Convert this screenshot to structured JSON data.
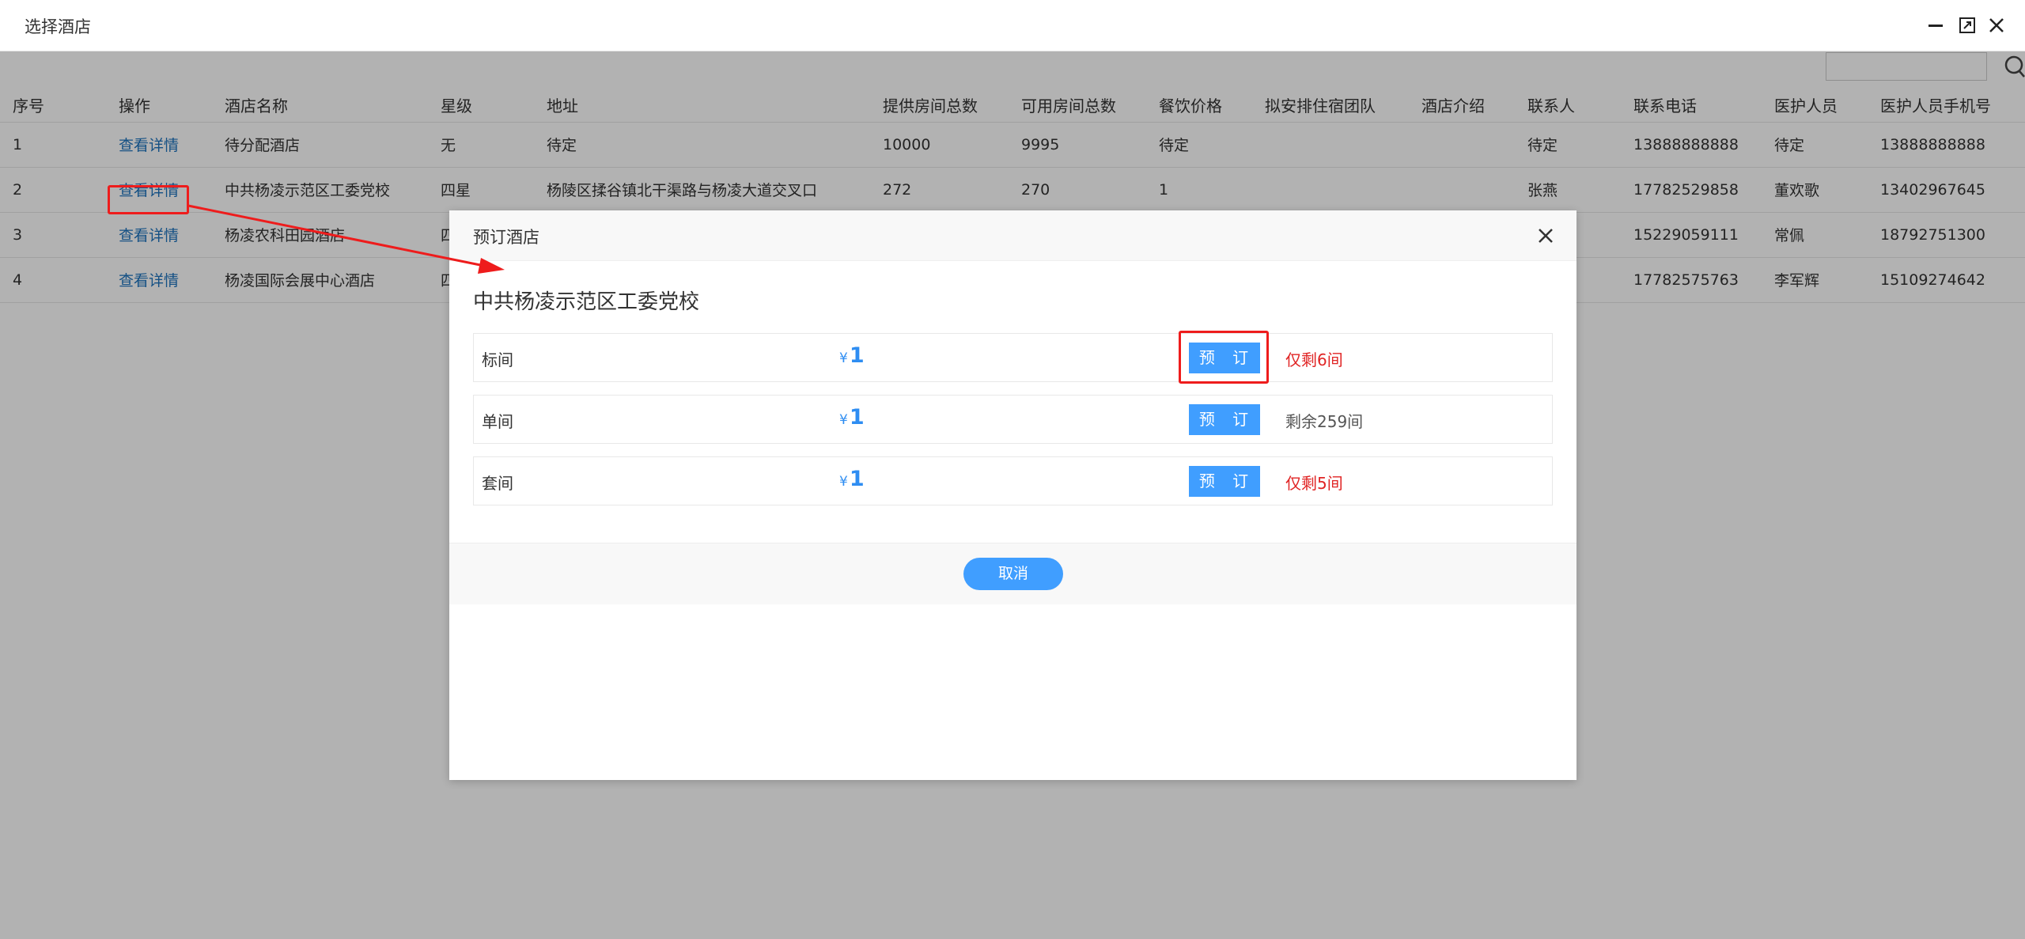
{
  "window": {
    "title": "选择酒店"
  },
  "table": {
    "columns": [
      "序号",
      "操作",
      "酒店名称",
      "星级",
      "地址",
      "提供房间总数",
      "可用房间总数",
      "餐饮价格",
      "拟安排住宿团队",
      "酒店介绍",
      "联系人",
      "联系电话",
      "医护人员",
      "医护人员手机号"
    ],
    "rows": [
      {
        "no": "1",
        "action": "查看详情",
        "name": "待分配酒店",
        "star": "无",
        "address": "待定",
        "total": "10000",
        "available": "9995",
        "food": "待定",
        "team": "",
        "intro": "",
        "contact": "待定",
        "phone": "13888888888",
        "medic": "待定",
        "medic_phone": "13888888888"
      },
      {
        "no": "2",
        "action": "查看详情",
        "name": "中共杨凌示范区工委党校",
        "star": "四星",
        "address": "杨陵区揉谷镇北干渠路与杨凌大道交叉口",
        "total": "272",
        "available": "270",
        "food": "1",
        "team": "",
        "intro": "",
        "contact": "张燕",
        "phone": "17782529858",
        "medic": "董欢歌",
        "medic_phone": "13402967645"
      },
      {
        "no": "3",
        "action": "查看详情",
        "name": "杨凌农科田园酒店",
        "star": "四",
        "address": "",
        "total": "",
        "available": "",
        "food": "",
        "team": "",
        "intro": "",
        "contact": "",
        "phone": "15229059111",
        "medic": "常佩",
        "medic_phone": "18792751300"
      },
      {
        "no": "4",
        "action": "查看详情",
        "name": "杨凌国际会展中心酒店",
        "star": "四",
        "address": "",
        "total": "",
        "available": "",
        "food": "",
        "team": "",
        "intro": "",
        "contact": "",
        "phone": "17782575763",
        "medic": "李军辉",
        "medic_phone": "15109274642"
      }
    ]
  },
  "modal": {
    "title": "预订酒店",
    "hotel_name": "中共杨凌示范区工委党校",
    "rooms": [
      {
        "type": "标间",
        "currency": "¥",
        "price": "1",
        "book_label": "预 订",
        "stock": "仅剩6间",
        "stock_level": "low"
      },
      {
        "type": "单间",
        "currency": "¥",
        "price": "1",
        "book_label": "预 订",
        "stock": "剩余259间",
        "stock_level": "normal"
      },
      {
        "type": "套间",
        "currency": "¥",
        "price": "1",
        "book_label": "预 订",
        "stock": "仅剩5间",
        "stock_level": "low"
      }
    ],
    "cancel_label": "取消"
  },
  "colors": {
    "primary": "#409eff",
    "link": "#1e73be",
    "warning": "#e02424",
    "annotation": "#ee1c1c"
  }
}
